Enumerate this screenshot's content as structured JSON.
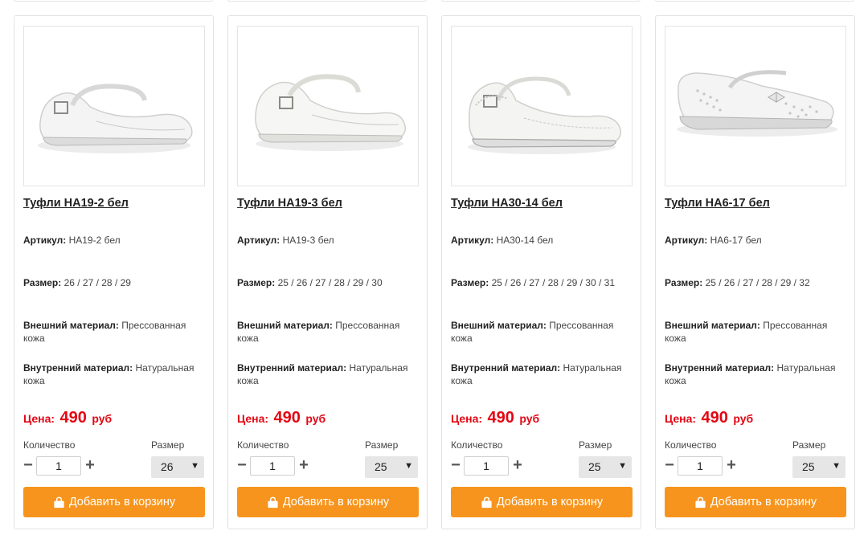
{
  "labels": {
    "article": "Артикул:",
    "size": "Размер:",
    "outer_material": "Внешний материал:",
    "inner_material": "Внутренний материал:",
    "price": "Цена:",
    "currency": "руб",
    "quantity": "Количество",
    "size_select": "Размер",
    "add_to_cart": "Добавить в корзину"
  },
  "colors": {
    "accent": "#f7941d",
    "price": "#e30613"
  },
  "icons": {
    "cart": "shopping-bag-icon",
    "minus": "minus-icon",
    "plus": "plus-icon",
    "caret": "caret-down-icon"
  },
  "products": [
    {
      "title": "Туфли НА19-2 бел",
      "article": "НА19-2 бел",
      "sizes": "26 / 27 / 28 / 29",
      "outer": "Прессованная кожа",
      "inner": "Натуральная кожа",
      "price": "490",
      "qty": "1",
      "selected_size": "26"
    },
    {
      "title": "Туфли НА19-3 бел",
      "article": "НА19-3 бел",
      "sizes": "25 / 26 / 27 / 28 / 29 / 30",
      "outer": "Прессованная кожа",
      "inner": "Натуральная кожа",
      "price": "490",
      "qty": "1",
      "selected_size": "25"
    },
    {
      "title": "Туфли НА30-14 бел",
      "article": "НА30-14 бел",
      "sizes": "25 / 26 / 27 / 28 / 29 / 30 / 31",
      "outer": "Прессованная кожа",
      "inner": "Натуральная кожа",
      "price": "490",
      "qty": "1",
      "selected_size": "25"
    },
    {
      "title": "Туфли НА6-17 бел",
      "article": "НА6-17 бел",
      "sizes": "25 / 26 / 27 / 28 / 29 / 32",
      "outer": "Прессованная кожа",
      "inner": "Натуральная кожа",
      "price": "490",
      "qty": "1",
      "selected_size": "25"
    }
  ]
}
